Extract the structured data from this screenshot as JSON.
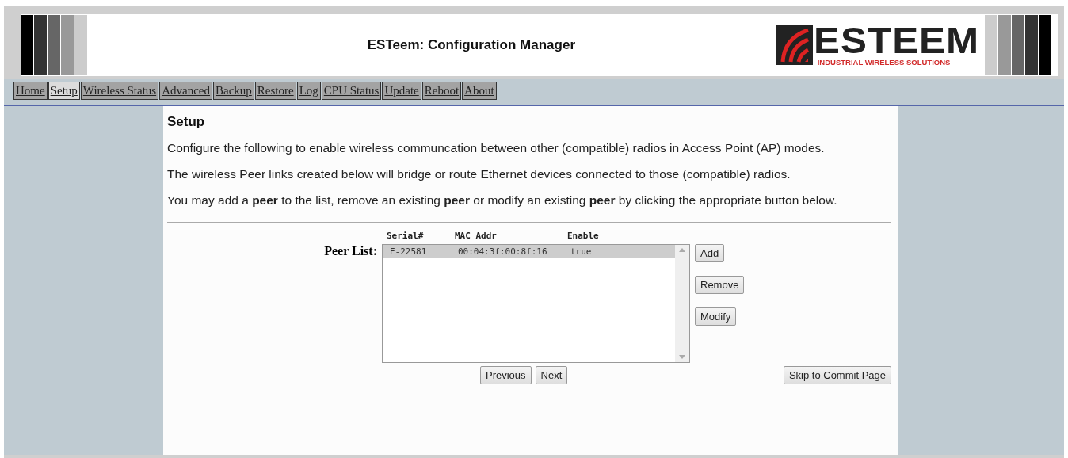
{
  "header": {
    "title": "ESTeem: Configuration Manager",
    "logo": {
      "name": "ESTEEM",
      "tagline": "INDUSTRIAL WIRELESS SOLUTIONS"
    }
  },
  "nav": [
    {
      "label": "Home",
      "selected": false
    },
    {
      "label": "Setup",
      "selected": true
    },
    {
      "label": "Wireless Status",
      "selected": false
    },
    {
      "label": "Advanced",
      "selected": false
    },
    {
      "label": "Backup",
      "selected": false
    },
    {
      "label": "Restore",
      "selected": false
    },
    {
      "label": "Log",
      "selected": false
    },
    {
      "label": "CPU Status",
      "selected": false
    },
    {
      "label": "Update",
      "selected": false
    },
    {
      "label": "Reboot",
      "selected": false
    },
    {
      "label": "About",
      "selected": false
    }
  ],
  "page": {
    "heading": "Setup",
    "paragraphs": [
      "Configure the following to enable wireless communcation between other (compatible) radios in Access Point (AP) modes.",
      "The wireless Peer links created below will bridge or route Ethernet devices connected to those (compatible) radios.",
      "You may add a **peer** to the list, remove an existing **peer** or modify an existing **peer** by clicking the appropriate button below."
    ]
  },
  "peer_list": {
    "label": "Peer List:",
    "columns": [
      "Serial#",
      "MAC Addr",
      "Enable"
    ],
    "rows": [
      {
        "serial": "E-22581",
        "mac": "00:04:3f:00:8f:16",
        "enable": "true",
        "selected": true
      }
    ],
    "side_buttons": [
      "Add",
      "Remove",
      "Modify"
    ],
    "nav_buttons": [
      "Previous",
      "Next"
    ],
    "skip_button": "Skip to Commit Page"
  }
}
